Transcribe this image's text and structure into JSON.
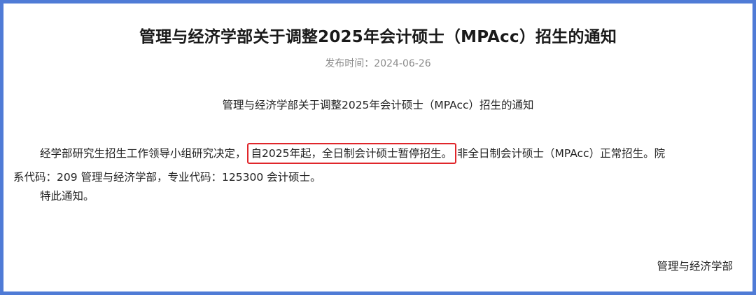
{
  "notice": {
    "title": "管理与经济学部关于调整2025年会计硕士（MPAcc）招生的通知",
    "publish_date": "发布时间：2024-06-26",
    "subtitle": "管理与经济学部关于调整2025年会计硕士（MPAcc）招生的通知",
    "body": {
      "part_before": "经学部研究生招生工作领导小组研究决定，",
      "highlighted": "自2025年起，全日制会计硕士暂停招生。",
      "part_after": "非全日制会计硕士（MPAcc）正常招生。院",
      "line2": "系代码：209 管理与经济学部，专业代码：125300 会计硕士。"
    },
    "closing": "特此通知。",
    "signature": "管理与经济学部"
  },
  "colors": {
    "frame_border": "#4f7bd6",
    "highlight_border": "#e0262b"
  }
}
